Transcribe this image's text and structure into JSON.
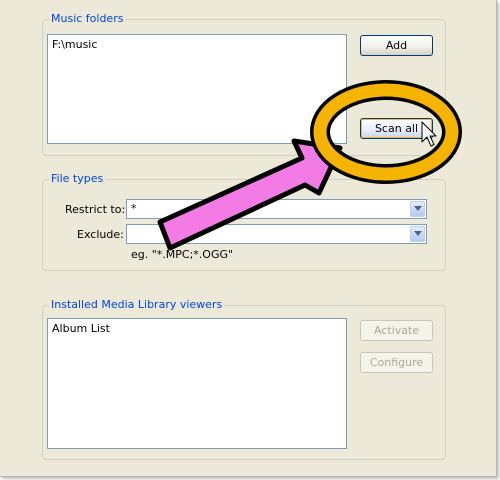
{
  "music_folders": {
    "title": "Music folders",
    "items": [
      "F:\\music"
    ],
    "add_label": "Add",
    "scan_all_label": "Scan all"
  },
  "file_types": {
    "title": "File types",
    "restrict_label": "Restrict to:",
    "restrict_value": "*",
    "exclude_label": "Exclude:",
    "exclude_value": "",
    "hint": "eg. \"*.MPC;*.OGG\""
  },
  "viewers": {
    "title": "Installed Media Library viewers",
    "items": [
      "Album List"
    ],
    "activate_label": "Activate",
    "configure_label": "Configure"
  },
  "colors": {
    "accent": "#0046d5",
    "annotation_ring": "#f5b400",
    "annotation_arrow": "#f27be6"
  }
}
